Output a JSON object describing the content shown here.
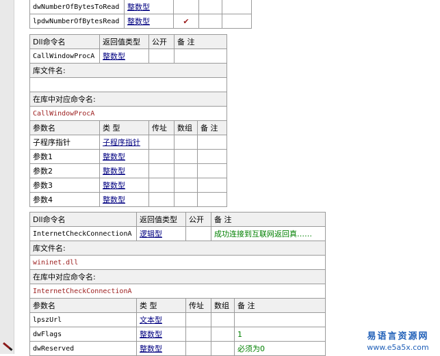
{
  "table0": {
    "rows": [
      {
        "name": "dwNumberOfBytesToRead",
        "type": "整数型",
        "byref": "",
        "array": "",
        "note": ""
      },
      {
        "name": "lpdwNumberOfBytesRead",
        "type": "整数型",
        "byref": "✔",
        "array": "",
        "note": ""
      }
    ]
  },
  "dll1": {
    "headers": {
      "name": "Dll命令名",
      "ret": "返回值类型",
      "public": "公开",
      "note": "备 注"
    },
    "name": "CallWindowProcA",
    "ret_type": "整数型",
    "public": "",
    "note": "",
    "lib_label": "库文件名:",
    "lib_value": "",
    "alias_label": "在库中对应命令名:",
    "alias_value": "CallWindowProcA",
    "param_headers": {
      "name": "参数名",
      "type": "类 型",
      "byref": "传址",
      "array": "数组",
      "note": "备 注"
    },
    "params": [
      {
        "name": "子程序指针",
        "type": "子程序指针"
      },
      {
        "name": "参数1",
        "type": "整数型"
      },
      {
        "name": "参数2",
        "type": "整数型"
      },
      {
        "name": "参数3",
        "type": "整数型"
      },
      {
        "name": "参数4",
        "type": "整数型"
      }
    ]
  },
  "dll2": {
    "headers": {
      "name": "Dll命令名",
      "ret": "返回值类型",
      "public": "公开",
      "note": "备 注"
    },
    "name": "InternetCheckConnectionA",
    "ret_type": "逻辑型",
    "public": "",
    "note": "成功连接到互联网返回真……",
    "lib_label": "库文件名:",
    "lib_value": "wininet.dll",
    "alias_label": "在库中对应命令名:",
    "alias_value": "InternetCheckConnectionA",
    "param_headers": {
      "name": "参数名",
      "type": "类 型",
      "byref": "传址",
      "array": "数组",
      "note": "备 注"
    },
    "params": [
      {
        "name": "lpszUrl",
        "type": "文本型",
        "note": ""
      },
      {
        "name": "dwFlags",
        "type": "整数型",
        "note": "1"
      },
      {
        "name": "dwReserved",
        "type": "整数型",
        "note": "必须为0"
      }
    ]
  },
  "logo": {
    "cn": "易语言资源网",
    "url": "www.e5a5x.com"
  }
}
